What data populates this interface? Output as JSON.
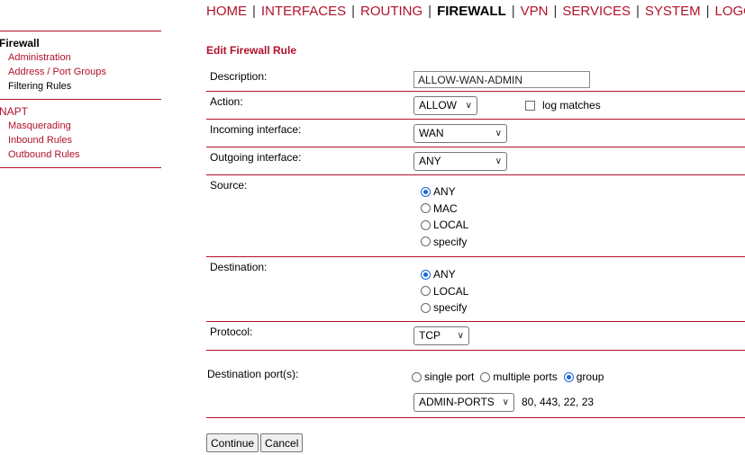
{
  "nav": {
    "items": [
      {
        "label": "HOME"
      },
      {
        "label": "INTERFACES"
      },
      {
        "label": "ROUTING"
      },
      {
        "label": "FIREWALL"
      },
      {
        "label": "VPN"
      },
      {
        "label": "SERVICES"
      },
      {
        "label": "SYSTEM"
      },
      {
        "label": "LOGOUT"
      }
    ],
    "separator": "|"
  },
  "sidebar": {
    "groups": [
      {
        "title": "Firewall",
        "items": [
          "Administration",
          "Address / Port Groups",
          "Filtering Rules"
        ]
      },
      {
        "title": "NAPT",
        "items": [
          "Masquerading",
          "Inbound Rules",
          "Outbound Rules"
        ]
      }
    ]
  },
  "form": {
    "title": "Edit Firewall Rule",
    "description": {
      "label": "Description:",
      "value": "ALLOW-WAN-ADMIN"
    },
    "action": {
      "label": "Action:",
      "selected": "ALLOW",
      "log_label": "log matches",
      "log_checked": false
    },
    "incoming": {
      "label": "Incoming interface:",
      "selected": "WAN"
    },
    "outgoing": {
      "label": "Outgoing interface:",
      "selected": "ANY"
    },
    "source": {
      "label": "Source:",
      "options": [
        "ANY",
        "MAC",
        "LOCAL",
        "specify"
      ],
      "selected": "ANY"
    },
    "destination": {
      "label": "Destination:",
      "options": [
        "ANY",
        "LOCAL",
        "specify"
      ],
      "selected": "ANY"
    },
    "protocol": {
      "label": "Protocol:",
      "selected": "TCP"
    },
    "ports": {
      "label": "Destination port(s):",
      "options": [
        "single port",
        "multiple ports",
        "group"
      ],
      "selected": "group",
      "group_selected": "ADMIN-PORTS",
      "group_ports": "80, 443, 22, 23"
    },
    "buttons": {
      "continue": "Continue",
      "cancel": "Cancel"
    }
  },
  "colors": {
    "accent": "#b0122b",
    "radio_selected": "#1a66d6"
  }
}
